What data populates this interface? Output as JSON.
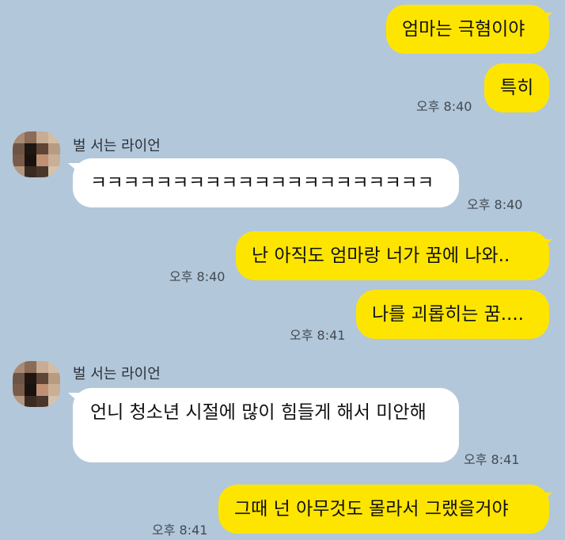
{
  "colors": {
    "background": "#b2c7da",
    "my_bubble": "#fee500",
    "their_bubble": "#ffffff"
  },
  "messages": [
    {
      "side": "mine",
      "text": "엄마는 극혐이야",
      "time": ""
    },
    {
      "side": "mine",
      "text": "특히",
      "time": "오후 8:40"
    },
    {
      "side": "theirs",
      "sender": "벌 서는 라이언",
      "text": "ㅋㅋㅋㅋㅋㅋㅋㅋㅋㅋㅋㅋㅋㅋㅋㅋㅋㅋㅋㅋㅋ",
      "time": "오후 8:40"
    },
    {
      "side": "mine",
      "text": "난 아직도 엄마랑 너가 꿈에 나와..",
      "time": "오후 8:40"
    },
    {
      "side": "mine",
      "text": "나를 괴롭히는 꿈....",
      "time": "오후 8:41"
    },
    {
      "side": "theirs",
      "sender": "벌 서는 라이언",
      "text": "언니 청소년 시절에 많이 힘들게 해서 미안해",
      "time": "오후 8:41"
    },
    {
      "side": "mine",
      "text": "그때 넌 아무것도 몰라서 그랬을거야",
      "time": "오후 8:41"
    }
  ]
}
